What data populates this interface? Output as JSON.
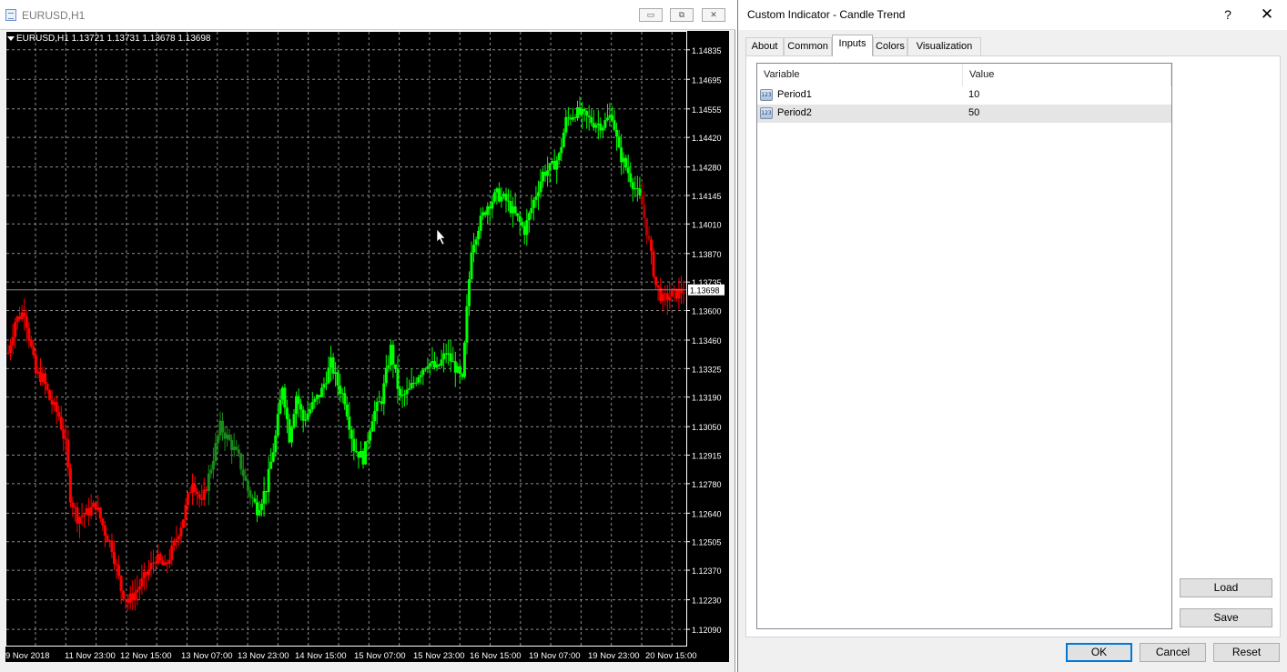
{
  "chart_window": {
    "title": "EURUSD,H1",
    "symbol_line": "EURUSD,H1  1.13721 1.13731 1.13678 1.13698",
    "current_price_label": "1.13698",
    "background_color": "#000000",
    "grid_color": "#8c8c8c",
    "bull_color": "#00ff00",
    "bear_color": "#ff0000",
    "dim_bull_color": "#1a8a1a",
    "dim_bear_color": "#b00000"
  },
  "chart_data": {
    "type": "candlestick",
    "symbol": "EURUSD",
    "timeframe": "H1",
    "ohlc_last": {
      "open": 1.13721,
      "high": 1.13731,
      "low": 1.13678,
      "close": 1.13698
    },
    "y_ticks": [
      "1.14835",
      "1.14695",
      "1.14555",
      "1.14420",
      "1.14280",
      "1.14145",
      "1.14010",
      "1.13870",
      "1.13735",
      "1.13600",
      "1.13460",
      "1.13325",
      "1.13190",
      "1.13050",
      "1.12915",
      "1.12780",
      "1.12640",
      "1.12505",
      "1.12370",
      "1.12230",
      "1.12090"
    ],
    "x_ticks": [
      "9 Nov 2018",
      "11 Nov 23:00",
      "12 Nov 15:00",
      "13 Nov 07:00",
      "13 Nov 23:00",
      "14 Nov 15:00",
      "15 Nov 07:00",
      "15 Nov 23:00",
      "16 Nov 15:00",
      "19 Nov 07:00",
      "19 Nov 23:00",
      "20 Nov 15:00"
    ],
    "ylim": [
      1.1203,
      1.1489
    ],
    "grid": true,
    "price_path": [
      {
        "t": 0,
        "p": 1.134
      },
      {
        "t": 3,
        "p": 1.1355
      },
      {
        "t": 7,
        "p": 1.136
      },
      {
        "t": 12,
        "p": 1.133
      },
      {
        "t": 15,
        "p": 1.1328
      },
      {
        "t": 18,
        "p": 1.1318
      },
      {
        "t": 22,
        "p": 1.131
      },
      {
        "t": 25,
        "p": 1.1296
      },
      {
        "t": 27,
        "p": 1.1272
      },
      {
        "t": 30,
        "p": 1.1262
      },
      {
        "t": 34,
        "p": 1.1264
      },
      {
        "t": 38,
        "p": 1.1268
      },
      {
        "t": 42,
        "p": 1.1255
      },
      {
        "t": 45,
        "p": 1.1248
      },
      {
        "t": 49,
        "p": 1.1228
      },
      {
        "t": 52,
        "p": 1.1222
      },
      {
        "t": 56,
        "p": 1.1228
      },
      {
        "t": 60,
        "p": 1.1235
      },
      {
        "t": 64,
        "p": 1.1243
      },
      {
        "t": 68,
        "p": 1.1238
      },
      {
        "t": 72,
        "p": 1.1249
      },
      {
        "t": 76,
        "p": 1.1262
      },
      {
        "t": 80,
        "p": 1.128
      },
      {
        "t": 84,
        "p": 1.1268
      },
      {
        "t": 88,
        "p": 1.1286
      },
      {
        "t": 92,
        "p": 1.1305
      },
      {
        "t": 96,
        "p": 1.1298
      },
      {
        "t": 100,
        "p": 1.129
      },
      {
        "t": 104,
        "p": 1.1275
      },
      {
        "t": 108,
        "p": 1.1266
      },
      {
        "t": 112,
        "p": 1.1276
      },
      {
        "t": 116,
        "p": 1.13
      },
      {
        "t": 119,
        "p": 1.1325
      },
      {
        "t": 122,
        "p": 1.13
      },
      {
        "t": 125,
        "p": 1.132
      },
      {
        "t": 128,
        "p": 1.1308
      },
      {
        "t": 132,
        "p": 1.1315
      },
      {
        "t": 136,
        "p": 1.1322
      },
      {
        "t": 140,
        "p": 1.1335
      },
      {
        "t": 143,
        "p": 1.1325
      },
      {
        "t": 146,
        "p": 1.1318
      },
      {
        "t": 150,
        "p": 1.1295
      },
      {
        "t": 154,
        "p": 1.129
      },
      {
        "t": 158,
        "p": 1.131
      },
      {
        "t": 162,
        "p": 1.1318
      },
      {
        "t": 166,
        "p": 1.1342
      },
      {
        "t": 170,
        "p": 1.1318
      },
      {
        "t": 174,
        "p": 1.1322
      },
      {
        "t": 178,
        "p": 1.133
      },
      {
        "t": 182,
        "p": 1.1336
      },
      {
        "t": 186,
        "p": 1.1332
      },
      {
        "t": 190,
        "p": 1.134
      },
      {
        "t": 194,
        "p": 1.1333
      },
      {
        "t": 197,
        "p": 1.1326
      },
      {
        "t": 199,
        "p": 1.136
      },
      {
        "t": 201,
        "p": 1.139
      },
      {
        "t": 204,
        "p": 1.14
      },
      {
        "t": 208,
        "p": 1.141
      },
      {
        "t": 212,
        "p": 1.1415
      },
      {
        "t": 216,
        "p": 1.1412
      },
      {
        "t": 220,
        "p": 1.1405
      },
      {
        "t": 224,
        "p": 1.1398
      },
      {
        "t": 228,
        "p": 1.1412
      },
      {
        "t": 232,
        "p": 1.1425
      },
      {
        "t": 236,
        "p": 1.1428
      },
      {
        "t": 239,
        "p": 1.1433
      },
      {
        "t": 242,
        "p": 1.145
      },
      {
        "t": 246,
        "p": 1.1454
      },
      {
        "t": 250,
        "p": 1.1452
      },
      {
        "t": 254,
        "p": 1.1449
      },
      {
        "t": 258,
        "p": 1.1448
      },
      {
        "t": 262,
        "p": 1.1453
      },
      {
        "t": 265,
        "p": 1.1435
      },
      {
        "t": 268,
        "p": 1.1428
      },
      {
        "t": 272,
        "p": 1.1418
      },
      {
        "t": 275,
        "p": 1.141
      },
      {
        "t": 278,
        "p": 1.1392
      },
      {
        "t": 281,
        "p": 1.1372
      },
      {
        "t": 284,
        "p": 1.1365
      },
      {
        "t": 287,
        "p": 1.1367
      },
      {
        "t": 290,
        "p": 1.1368
      },
      {
        "t": 293,
        "p": 1.137
      }
    ],
    "color_segments": [
      {
        "from": 0,
        "to": 87,
        "trend": "bear"
      },
      {
        "from": 87,
        "to": 107,
        "trend": "bull_dim"
      },
      {
        "from": 107,
        "to": 275,
        "trend": "bull"
      },
      {
        "from": 275,
        "to": 279,
        "trend": "bear_dim"
      },
      {
        "from": 279,
        "to": 294,
        "trend": "bear"
      }
    ]
  },
  "dialog": {
    "title": "Custom Indicator - Candle Trend",
    "help_label": "?",
    "close_label": "✕",
    "tabs": [
      {
        "label": "About",
        "active": false
      },
      {
        "label": "Common",
        "active": false
      },
      {
        "label": "Inputs",
        "active": true
      },
      {
        "label": "Colors",
        "active": false
      },
      {
        "label": "Visualization",
        "active": false
      }
    ],
    "columns": {
      "variable": "Variable",
      "value": "Value"
    },
    "params": [
      {
        "icon": "numeric-param-icon",
        "icon_text": "123",
        "name": "Period1",
        "value": "10",
        "selected": false
      },
      {
        "icon": "numeric-param-icon",
        "icon_text": "123",
        "name": "Period2",
        "value": "50",
        "selected": true
      }
    ],
    "buttons": {
      "load": "Load",
      "save": "Save",
      "ok": "OK",
      "cancel": "Cancel",
      "reset": "Reset"
    }
  }
}
